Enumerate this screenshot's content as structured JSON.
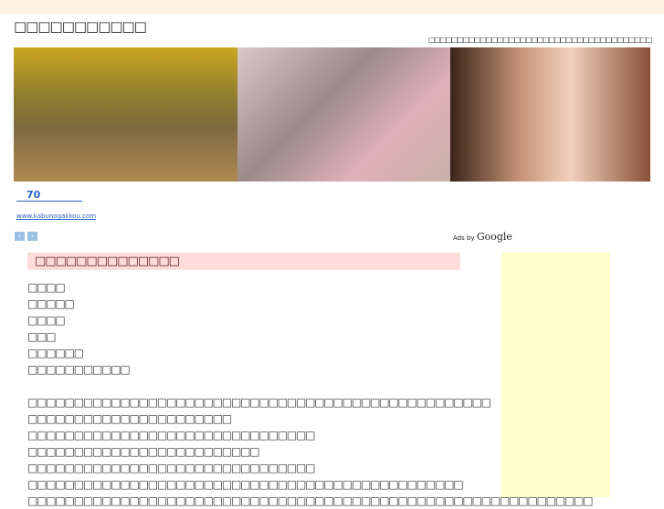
{
  "site": {
    "title": "□□□□□□□□□□□",
    "tagline": "□□□□□□□□□□□□□□□□□□□□□□□□□□□□□□□□□□□□□□□"
  },
  "ad": {
    "link_text": "70",
    "url": "www.kabunogakkou.com",
    "prev": "‹",
    "next": "›",
    "ads_by": "Ads by",
    "google": "Google"
  },
  "article": {
    "heading": "□□□□□□□□□□□□□□",
    "list": [
      "□□□□",
      "□□□□□",
      "□□□□",
      "□□□",
      "□□□□□□",
      "□□□□□□□□□□□"
    ],
    "paragraphs": [
      "□□□□□□□□□□□□□□□□□□□□□□□□□□□□□□□□□□□□□□□□□□□□□□□□□□",
      "□□□□□□□□□□□□□□□□□□□□□□",
      "□□□□□□□□□□□□□□□□□□□□□□□□□□□□□□□",
      "□□□□□□□□□□□□□□□□□□□□□□□□□",
      "□□□□□□□□□□□□□□□□□□□□□□□□□□□□□□□",
      "□□□□□□□□□□□□□□□□□□□□□□□□□□□□□□□□□□□□□□□□□□□□□□□",
      "□□□□□□□□□□□□□□□□□□□□□□□□□□□□□□□□□□□□□□□□□□□□□□□□□□□□□□□□□□□□□"
    ]
  }
}
